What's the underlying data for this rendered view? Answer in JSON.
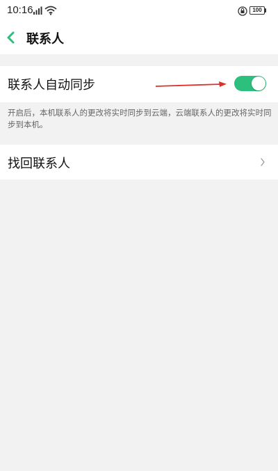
{
  "status_bar": {
    "time": "10:16",
    "battery": "100",
    "icons": [
      "signal-icon",
      "wifi-icon",
      "lock-icon",
      "battery-icon"
    ]
  },
  "header": {
    "title": "联系人",
    "back_icon": "chevron-left-icon",
    "back_color": "#2dbf7d"
  },
  "sync_setting": {
    "label": "联系人自动同步",
    "enabled": true,
    "toggle_color": "#2dbf7d",
    "description": "开启后，本机联系人的更改将实时同步到云端，云端联系人的更改将实时同步到本机。"
  },
  "retrieve_contacts": {
    "label": "找回联系人",
    "icon": "chevron-right-icon"
  },
  "annotation": {
    "icon": "red-arrow-icon",
    "color": "#d9322b"
  }
}
